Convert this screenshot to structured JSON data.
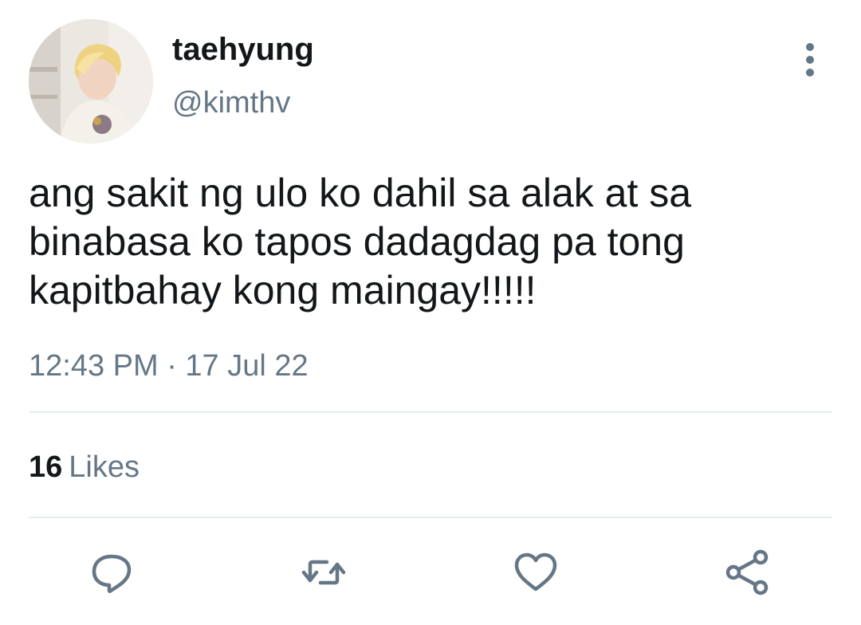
{
  "tweet": {
    "display_name": "taehyung",
    "handle": "@kimthv",
    "text": "ang sakit ng ulo ko dahil sa alak at sa binabasa ko tapos dadagdag pa tong kapitbahay kong maingay!!!!!",
    "timestamp": "12:43 PM · 17 Jul 22",
    "likes": {
      "count": "16",
      "label": "Likes"
    }
  },
  "icons": {
    "more": "more-vertical-icon",
    "reply": "reply-icon",
    "retweet": "retweet-icon",
    "like": "heart-icon",
    "share": "share-icon"
  },
  "colors": {
    "primary_text": "#14171a",
    "secondary_text": "#657786",
    "icon": "#657786",
    "divider": "#e6ecf0"
  }
}
